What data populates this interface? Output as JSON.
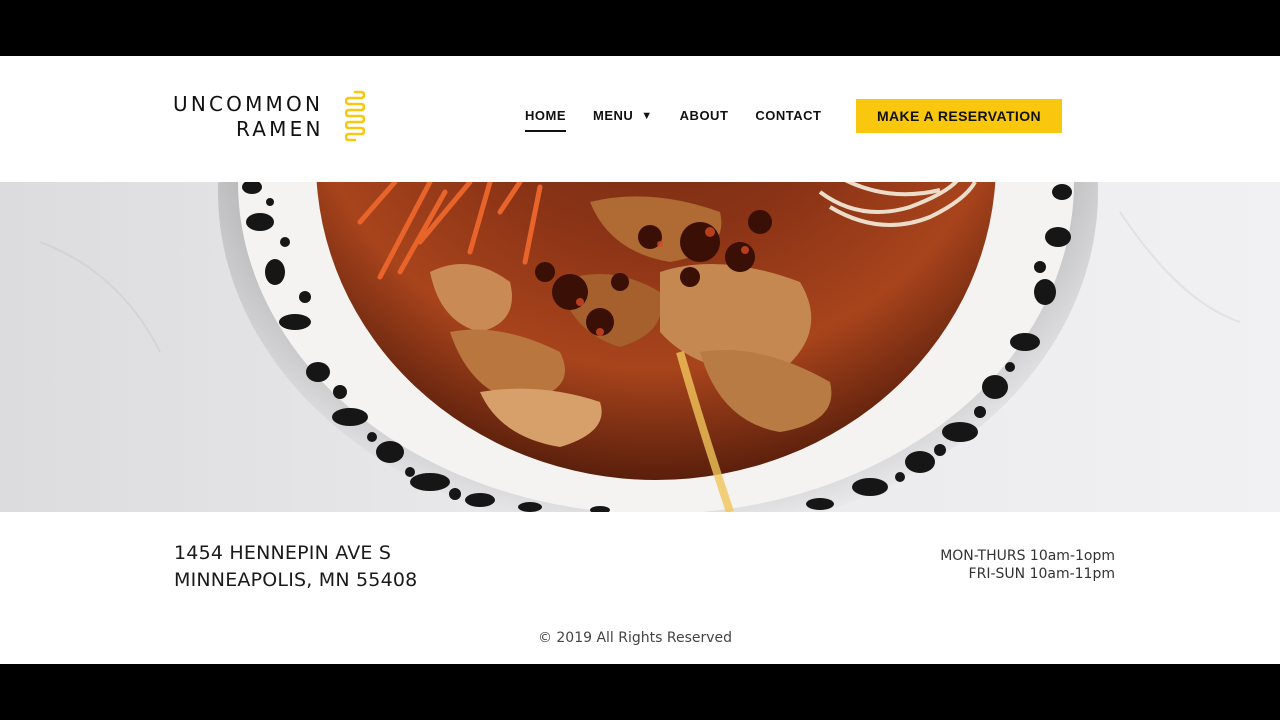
{
  "brand": {
    "line1": "UNCOMMON",
    "line2": "RAMEN",
    "accent_color": "#f9c80e"
  },
  "nav": {
    "items": [
      {
        "label": "HOME",
        "active": true
      },
      {
        "label": "MENU",
        "has_dropdown": true,
        "caret": "▼"
      },
      {
        "label": "ABOUT"
      },
      {
        "label": "CONTACT"
      }
    ]
  },
  "cta": {
    "label": "MAKE A RESERVATION"
  },
  "hero": {
    "icon": "ramen-bowl-photo"
  },
  "footer": {
    "address_line1": "1454 HENNEPIN AVE S",
    "address_line2": "MINNEAPOLIS, MN 55408",
    "hours_line1": "MON-THURS 10am-1opm",
    "hours_line2": "FRI-SUN 10am-11pm",
    "copyright": "© 2019 All Rights Reserved"
  }
}
